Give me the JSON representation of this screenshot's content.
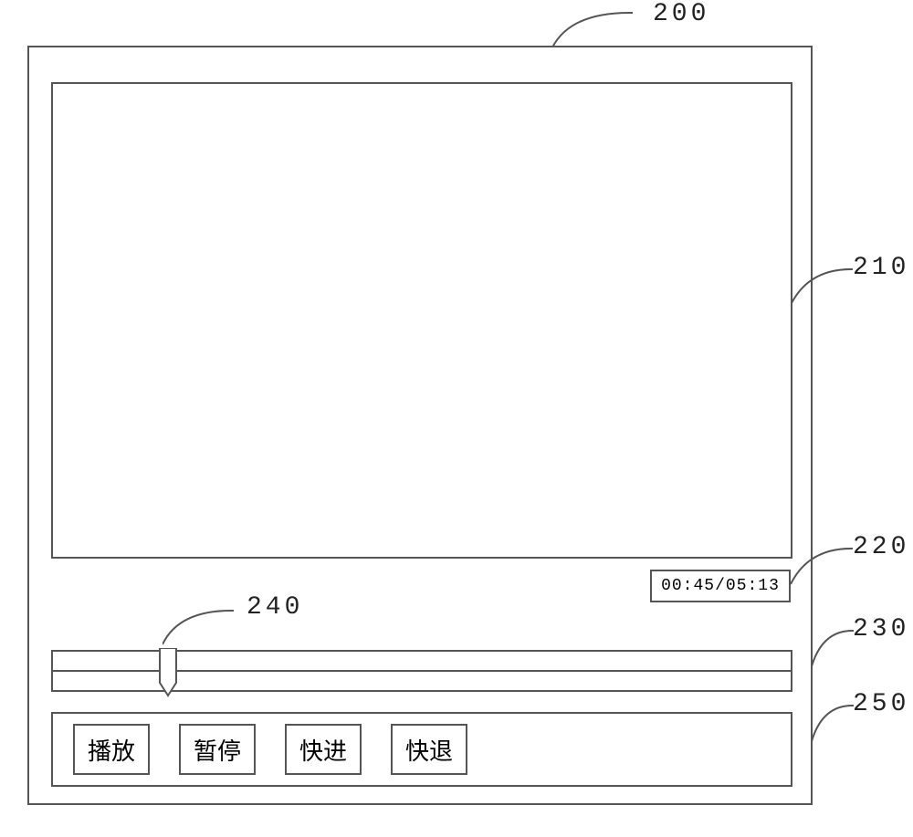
{
  "refs": {
    "frame": "200",
    "video": "210",
    "timebox": "220",
    "progress": "230",
    "slider": "240",
    "controls": "250"
  },
  "time": {
    "display": "00:45/05:13"
  },
  "controls": {
    "play": "播放",
    "pause": "暂停",
    "fastforward": "快进",
    "rewind": "快退"
  }
}
